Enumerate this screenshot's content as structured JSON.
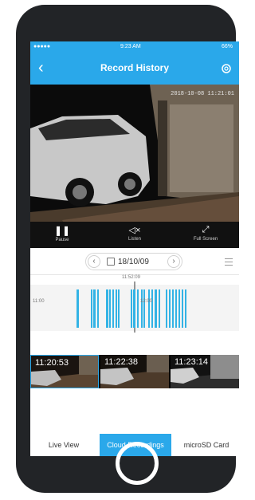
{
  "status": {
    "left": "●●●●● ",
    "time": "9:23 AM",
    "right": "66%"
  },
  "nav": {
    "title": "Record History"
  },
  "video": {
    "timestamp": "2018-10-08 11:21:01"
  },
  "controls": {
    "pause": "Pause",
    "listen": "Listen",
    "fullscreen": "Full Screen"
  },
  "date": {
    "value": "18/10/09"
  },
  "timeline": {
    "marker": "11:52:09",
    "hour_left": "11:00",
    "hour_mid": "12:00"
  },
  "thumbs": [
    {
      "time": "11:20:53"
    },
    {
      "time": "11:22:38"
    },
    {
      "time": "11:23:14"
    }
  ],
  "tabs": [
    {
      "label": "Live View"
    },
    {
      "label": "Cloud Recordings"
    },
    {
      "label": "microSD Card"
    }
  ],
  "colors": {
    "accent": "#2aa8ea",
    "bar": "#33b3e5"
  }
}
